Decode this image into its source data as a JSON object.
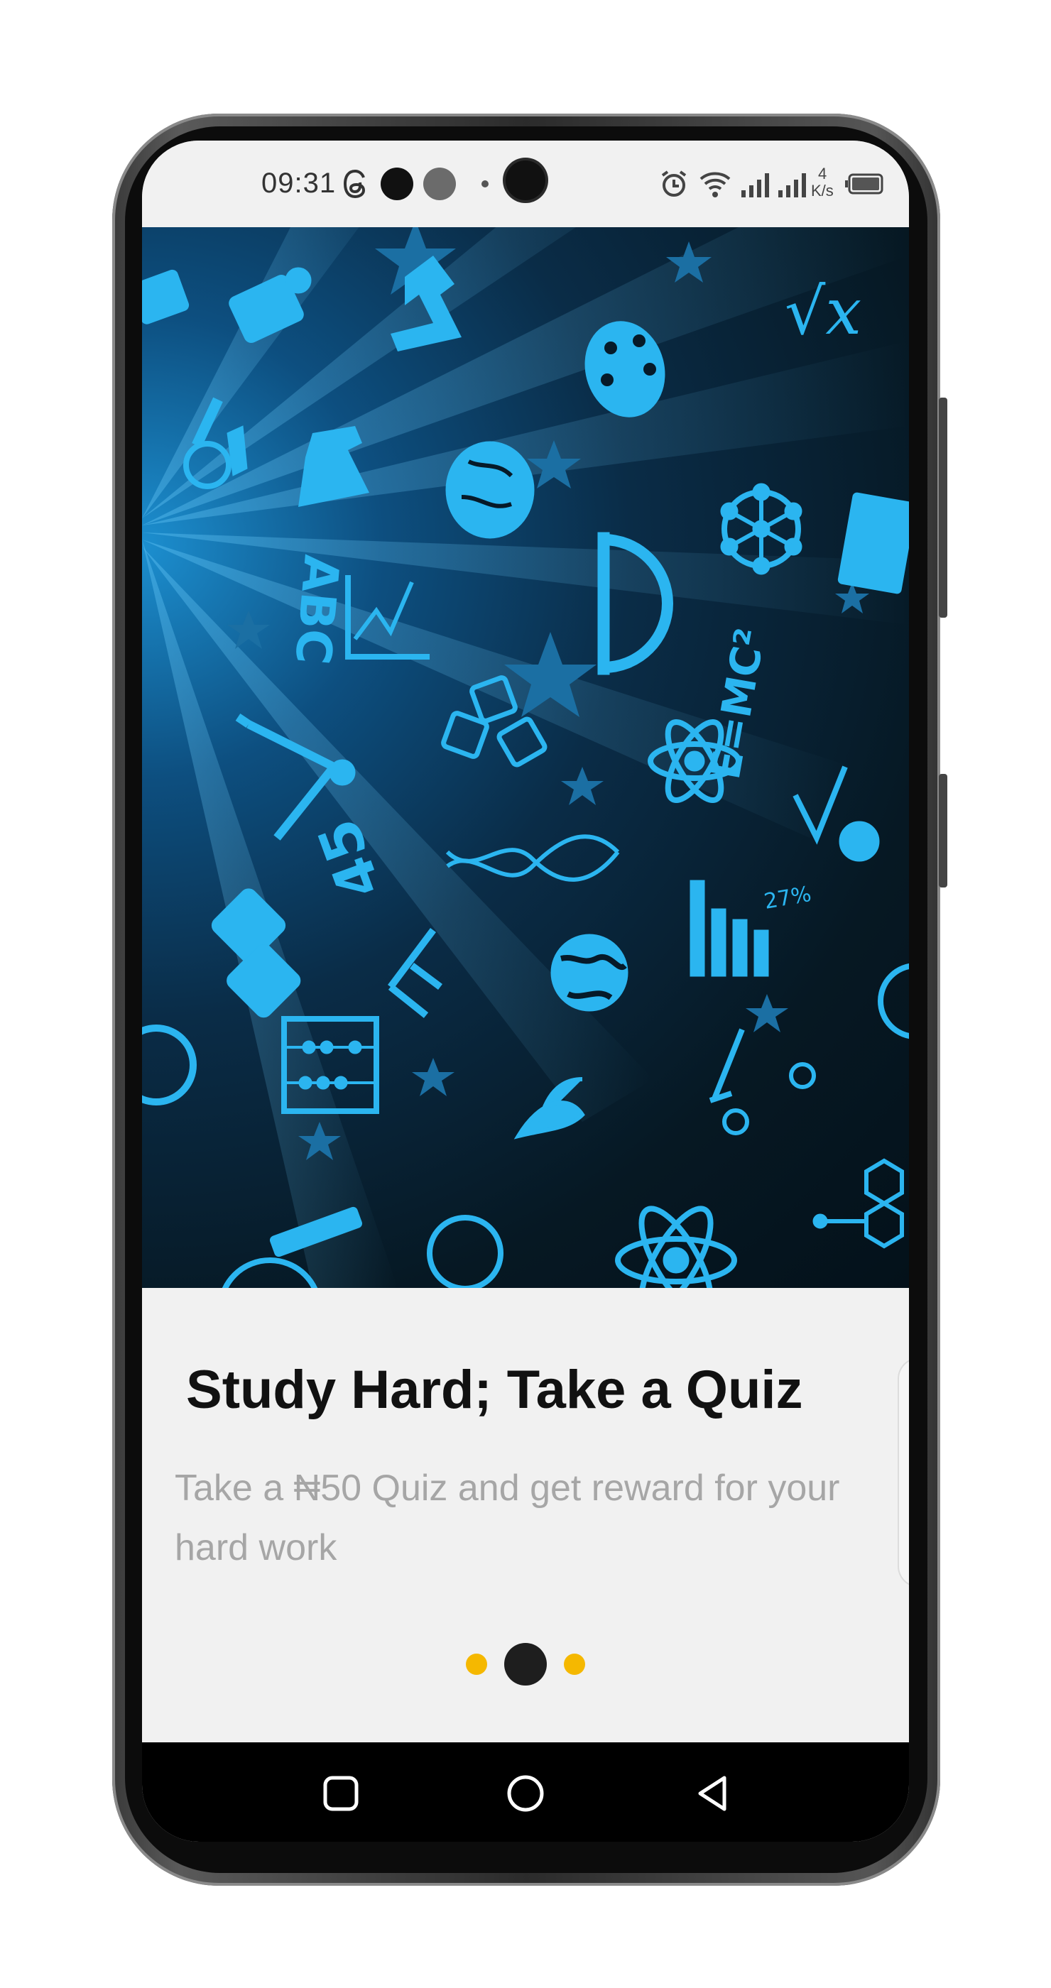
{
  "status_bar": {
    "time": "09:31",
    "network_speed_value": "4",
    "network_speed_unit": "K/s",
    "icons": [
      "threads-icon",
      "notification-dot-icon",
      "notification-dot-icon",
      "small-dot-icon",
      "alarm-icon",
      "wifi-icon",
      "signal-icon",
      "signal-icon",
      "battery-icon"
    ]
  },
  "onboarding": {
    "title": "Study Hard; Take a Quiz",
    "subtitle": "Take a ₦50 Quiz and get reward for your hard work",
    "page_indicator": {
      "total": 3,
      "active_index": 1
    }
  },
  "hero_image": {
    "label_abc": "ABC",
    "label_formula": "E=MC²",
    "label_percent": "27%",
    "label_sqrt": "√x",
    "label_number": "45"
  },
  "nav_bar": {
    "recent": "recent-apps-icon",
    "home": "home-icon",
    "back": "back-icon"
  },
  "colors": {
    "accent": "#F5B800",
    "active_dot": "#1E1E1E",
    "hero_icon": "#2BB5F0",
    "background": "#F1F1F1"
  }
}
